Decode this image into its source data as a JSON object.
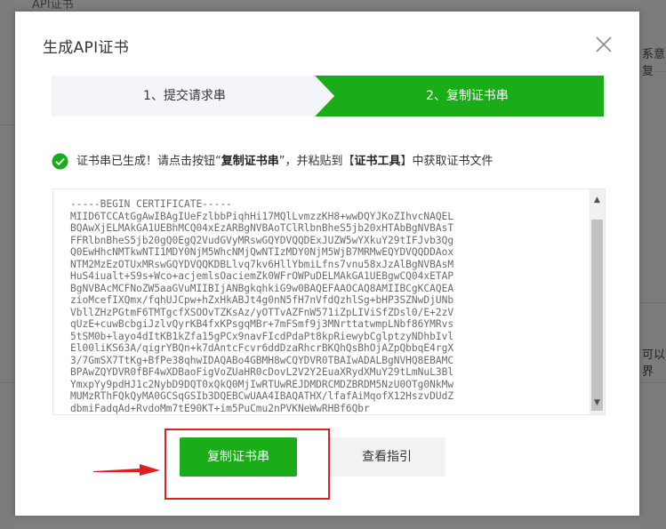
{
  "background": {
    "top_text": "API证书",
    "right_text_1": "系意复",
    "right_text_2": "可以界"
  },
  "dialog": {
    "title": "生成API证书",
    "steps": [
      {
        "label": "1、提交请求串",
        "active": false
      },
      {
        "label": "2、复制证书串",
        "active": true
      }
    ],
    "message": {
      "prefix": "证书串已生成！请点击按钮“",
      "bold1": "复制证书串",
      "middle": "”，并粘贴到【",
      "bold2": "证书工具",
      "suffix": "】中获取证书文件"
    },
    "certificate": "-----BEGIN CERTIFICATE-----\nMIID6TCCAtGgAwIBAgIUeFzlbbPiqhHi17MQlLvmzzKH8+wwDQYJKoZIhvcNAQEL\nBQAwXjELMAkGA1UEBhMCQ04xEzARBgNVBAoTClRlbnBheS5jb20xHTAbBgNVBAsT\nFFRlbnBheS5jb20gQ0EgQ2VudGVyMRswGQYDVQQDExJUZW5wYXkuY29tIFJvb3Qg\nQ0EwHhcNMTkwNTI1MDY0NjM5WhcNMjQwNTIzMDY0NjM5WjB7MRMwEQYDVQQDDAox\nNTM2MzEzOTUxMRswGQYDVQQKDBLlvq7kv6HllYbmiLfns7vnu58xJzAlBgNVBAsM\nHuS4iualt+S9s+Wco+acjemlsOaciemZk0WFrOWPuDELMAkGA1UEBgwCQ04xETAP\nBgNVBAcMCFNoZW5aaGVuMIIBIjANBgkqhkiG9w0BAQEFAAOCAQ8AMIIBCgKCAQEA\nzioMcefIXQmx/fqhUJCpw+hZxHkABJt4g0nN5fH7nVfdQzhlSg+bHP3SZNwDjUNb\nVbllZHzPGtmF6TMTgcfXSOOvTZKsAz/yOTTvAZFnW571iZpLIViSfZDsl0/E+2zV\nqUzE+cuwBcbgiJzlvQyrKB4fxKPsgqMBr+7mFSmf9j3MNrttatwmpLNbf86YMRvs\n5tSM0b+layo4dItKB1kZfa15gPCx9navFIcdPdaPt8kpRiewybCglptzyNDhbIvl\nEl00liKS63A/qigrYBQn+k7dAntcFcvr6ddDzaRhcrBKQhQsBhOjAZpQbbqE4rgX\n3/7GmSX7TtKg+BfPe38qhwIDAQABo4GBMH8wCQYDVR0TBAIwADALBgNVHQ8EBAMC\nBPAwZQYDVR0fBF4wXDBaoFigVoZUaHR0cDovL2V2Y2EuaXRydXMuY29tLmNuL3Bl\nYmxpYy9pdHJ1c2NybD9DQT0xQkQ0MjIwRTUwREJDMDRCMDZBRDM5NzU0OTg0NkMw\nMUMzRThFQkQyMA0GCSqGSIb3DQEBCwUAA4IBAQATHX/lfafAiMqofX12HszvDUdZ\ndbmiFadqAd+RvdoMm7tE90KT+im5PuCmu2nPVKNeWwRHBf6Qbr"
  }
}
